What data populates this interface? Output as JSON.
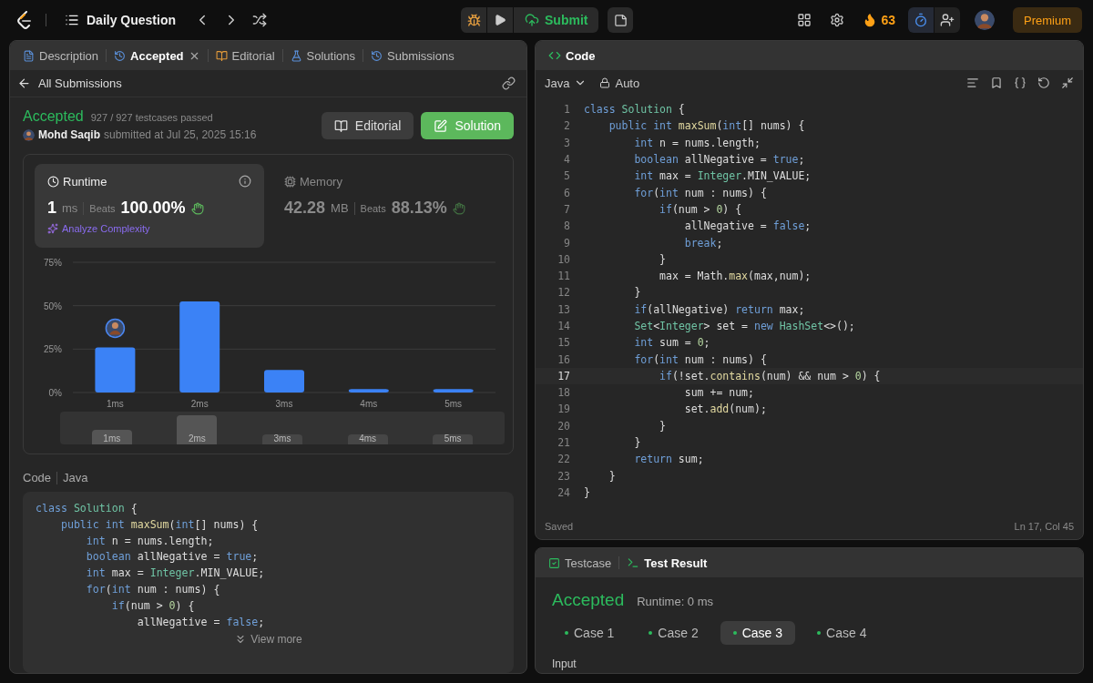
{
  "topbar": {
    "title": "Daily Question",
    "submit": "Submit",
    "streak": "63",
    "premium": "Premium"
  },
  "left": {
    "tabs": [
      {
        "label": "Description",
        "kind": "description",
        "selected": false
      },
      {
        "label": "Accepted",
        "kind": "accepted",
        "selected": true
      },
      {
        "label": "Editorial",
        "kind": "editorial",
        "selected": false
      },
      {
        "label": "Solutions",
        "kind": "solutions",
        "selected": false
      },
      {
        "label": "Submissions",
        "kind": "submissions",
        "selected": false
      }
    ],
    "back_link": "All Submissions",
    "result": {
      "status": "Accepted",
      "testcases": "927 / 927 testcases passed",
      "author": "Mohd Saqib",
      "submitted": "submitted at Jul 25, 2025 15:16"
    },
    "buttons": [
      {
        "label": "Editorial",
        "kind": "secondary"
      },
      {
        "label": "Solution",
        "kind": "primary"
      }
    ],
    "metrics": [
      {
        "kind": "runtime",
        "title": "Runtime",
        "value": "1",
        "unit": "ms",
        "beats_label": "Beats",
        "beats": "100.00%",
        "action": "Analyze Complexity",
        "selected": true
      },
      {
        "kind": "memory",
        "title": "Memory",
        "value": "42.28",
        "unit": "MB",
        "beats_label": "Beats",
        "beats": "88.13%",
        "selected": false
      }
    ],
    "chart_data": {
      "type": "bar",
      "categories": [
        "1ms",
        "2ms",
        "3ms",
        "4ms",
        "5ms"
      ],
      "series": [
        {
          "color": "#3b82f6",
          "values": [
            26,
            52.5,
            13,
            2,
            2
          ]
        }
      ],
      "ylim": [
        0,
        75
      ],
      "yticks": [
        {
          "value": 0,
          "label": "0%"
        },
        {
          "value": 25,
          "label": "25%"
        },
        {
          "value": 50,
          "label": "50%"
        },
        {
          "value": 75,
          "label": "75%"
        }
      ],
      "annotations": [
        {
          "x": "1ms"
        }
      ]
    },
    "overview_labels": [
      "1ms",
      "2ms",
      "3ms",
      "4ms",
      "5ms"
    ],
    "code_preview": {
      "label": "Code",
      "language": "Java",
      "view_more": "View more",
      "lines": [
        {
          "tokens": [
            {
              "kind": "kw",
              "text": "class "
            },
            {
              "kind": "type",
              "text": "Solution"
            },
            {
              "kind": "plain",
              "text": " {"
            }
          ]
        },
        {
          "tokens": [
            {
              "kind": "kw",
              "text": "    public int "
            },
            {
              "kind": "fn",
              "text": "maxSum"
            },
            {
              "kind": "plain",
              "text": "("
            },
            {
              "kind": "kw",
              "text": "int"
            },
            {
              "kind": "plain",
              "text": "[] nums) {"
            }
          ]
        },
        {
          "tokens": [
            {
              "kind": "kw",
              "text": "        int "
            },
            {
              "kind": "plain",
              "text": "n = nums.length;"
            }
          ]
        },
        {
          "tokens": [
            {
              "kind": "kw",
              "text": "        boolean "
            },
            {
              "kind": "plain",
              "text": "allNegative = "
            },
            {
              "kind": "kw",
              "text": "true"
            },
            {
              "kind": "plain",
              "text": ";"
            }
          ]
        },
        {
          "tokens": [
            {
              "kind": "kw",
              "text": "        int "
            },
            {
              "kind": "plain",
              "text": "max = "
            },
            {
              "kind": "type",
              "text": "Integer"
            },
            {
              "kind": "plain",
              "text": ".MIN_VALUE;"
            }
          ]
        },
        {
          "tokens": [
            {
              "kind": "kw",
              "text": "        for"
            },
            {
              "kind": "plain",
              "text": "("
            },
            {
              "kind": "kw",
              "text": "int "
            },
            {
              "kind": "plain",
              "text": "num : nums) {"
            }
          ]
        },
        {
          "tokens": [
            {
              "kind": "kw",
              "text": "            if"
            },
            {
              "kind": "plain",
              "text": "(num > "
            },
            {
              "kind": "num",
              "text": "0"
            },
            {
              "kind": "plain",
              "text": ") {"
            }
          ]
        },
        {
          "tokens": [
            {
              "kind": "plain",
              "text": "                allNegative = "
            },
            {
              "kind": "kw",
              "text": "false"
            },
            {
              "kind": "plain",
              "text": ";"
            }
          ]
        }
      ]
    }
  },
  "editor": {
    "title": "Code",
    "language": "Java",
    "mode": "Auto",
    "status_left": "Saved",
    "status_right": "Ln 17, Col 45",
    "lines": [
      {
        "number": "1",
        "current": false,
        "tokens": [
          {
            "kind": "kw",
            "text": "class "
          },
          {
            "kind": "type",
            "text": "Solution"
          },
          {
            "kind": "plain",
            "text": " {"
          }
        ]
      },
      {
        "number": "2",
        "current": false,
        "tokens": [
          {
            "kind": "kw",
            "text": "    public int "
          },
          {
            "kind": "fn",
            "text": "maxSum"
          },
          {
            "kind": "plain",
            "text": "("
          },
          {
            "kind": "kw",
            "text": "int"
          },
          {
            "kind": "plain",
            "text": "[] nums) {"
          }
        ]
      },
      {
        "number": "3",
        "current": false,
        "tokens": [
          {
            "kind": "kw",
            "text": "        int "
          },
          {
            "kind": "plain",
            "text": "n = nums.length;"
          }
        ]
      },
      {
        "number": "4",
        "current": false,
        "tokens": [
          {
            "kind": "kw",
            "text": "        boolean "
          },
          {
            "kind": "plain",
            "text": "allNegative = "
          },
          {
            "kind": "kw",
            "text": "true"
          },
          {
            "kind": "plain",
            "text": ";"
          }
        ]
      },
      {
        "number": "5",
        "current": false,
        "tokens": [
          {
            "kind": "kw",
            "text": "        int "
          },
          {
            "kind": "plain",
            "text": "max = "
          },
          {
            "kind": "type",
            "text": "Integer"
          },
          {
            "kind": "plain",
            "text": ".MIN_VALUE;"
          }
        ]
      },
      {
        "number": "6",
        "current": false,
        "tokens": [
          {
            "kind": "kw",
            "text": "        for"
          },
          {
            "kind": "plain",
            "text": "("
          },
          {
            "kind": "kw",
            "text": "int "
          },
          {
            "kind": "plain",
            "text": "num : nums) {"
          }
        ]
      },
      {
        "number": "7",
        "current": false,
        "tokens": [
          {
            "kind": "kw",
            "text": "            if"
          },
          {
            "kind": "plain",
            "text": "(num > "
          },
          {
            "kind": "num",
            "text": "0"
          },
          {
            "kind": "plain",
            "text": ") {"
          }
        ]
      },
      {
        "number": "8",
        "current": false,
        "tokens": [
          {
            "kind": "plain",
            "text": "                allNegative = "
          },
          {
            "kind": "kw",
            "text": "false"
          },
          {
            "kind": "plain",
            "text": ";"
          }
        ]
      },
      {
        "number": "9",
        "current": false,
        "tokens": [
          {
            "kind": "kw",
            "text": "                break"
          },
          {
            "kind": "plain",
            "text": ";"
          }
        ]
      },
      {
        "number": "10",
        "current": false,
        "tokens": [
          {
            "kind": "plain",
            "text": "            }"
          }
        ]
      },
      {
        "number": "11",
        "current": false,
        "tokens": [
          {
            "kind": "plain",
            "text": "            max = Math."
          },
          {
            "kind": "fn",
            "text": "max"
          },
          {
            "kind": "plain",
            "text": "(max,num);"
          }
        ]
      },
      {
        "number": "12",
        "current": false,
        "tokens": [
          {
            "kind": "plain",
            "text": "        }"
          }
        ]
      },
      {
        "number": "13",
        "current": false,
        "tokens": [
          {
            "kind": "kw",
            "text": "        if"
          },
          {
            "kind": "plain",
            "text": "(allNegative) "
          },
          {
            "kind": "kw",
            "text": "return "
          },
          {
            "kind": "plain",
            "text": "max;"
          }
        ]
      },
      {
        "number": "14",
        "current": false,
        "tokens": [
          {
            "kind": "type",
            "text": "        Set"
          },
          {
            "kind": "plain",
            "text": "<"
          },
          {
            "kind": "type",
            "text": "Integer"
          },
          {
            "kind": "plain",
            "text": "> set = "
          },
          {
            "kind": "kw",
            "text": "new "
          },
          {
            "kind": "type",
            "text": "HashSet"
          },
          {
            "kind": "plain",
            "text": "<>();"
          }
        ]
      },
      {
        "number": "15",
        "current": false,
        "tokens": [
          {
            "kind": "kw",
            "text": "        int "
          },
          {
            "kind": "plain",
            "text": "sum = "
          },
          {
            "kind": "num",
            "text": "0"
          },
          {
            "kind": "plain",
            "text": ";"
          }
        ]
      },
      {
        "number": "16",
        "current": false,
        "tokens": [
          {
            "kind": "kw",
            "text": "        for"
          },
          {
            "kind": "plain",
            "text": "("
          },
          {
            "kind": "kw",
            "text": "int "
          },
          {
            "kind": "plain",
            "text": "num : nums) {"
          }
        ]
      },
      {
        "number": "17",
        "current": true,
        "tokens": [
          {
            "kind": "kw",
            "text": "            if"
          },
          {
            "kind": "plain",
            "text": "(!set."
          },
          {
            "kind": "fn",
            "text": "contains"
          },
          {
            "kind": "plain",
            "text": "(num) && num > "
          },
          {
            "kind": "num",
            "text": "0"
          },
          {
            "kind": "plain",
            "text": ") {"
          }
        ]
      },
      {
        "number": "18",
        "current": false,
        "tokens": [
          {
            "kind": "plain",
            "text": "                sum += num;"
          }
        ]
      },
      {
        "number": "19",
        "current": false,
        "tokens": [
          {
            "kind": "plain",
            "text": "                set."
          },
          {
            "kind": "fn",
            "text": "add"
          },
          {
            "kind": "plain",
            "text": "(num);"
          }
        ]
      },
      {
        "number": "20",
        "current": false,
        "tokens": [
          {
            "kind": "plain",
            "text": "            }"
          }
        ]
      },
      {
        "number": "21",
        "current": false,
        "tokens": [
          {
            "kind": "plain",
            "text": "        }"
          }
        ]
      },
      {
        "number": "22",
        "current": false,
        "tokens": [
          {
            "kind": "kw",
            "text": "        return "
          },
          {
            "kind": "plain",
            "text": "sum;"
          }
        ]
      },
      {
        "number": "23",
        "current": false,
        "tokens": [
          {
            "kind": "plain",
            "text": "    }"
          }
        ]
      },
      {
        "number": "24",
        "current": false,
        "tokens": [
          {
            "kind": "plain",
            "text": "}"
          }
        ]
      }
    ]
  },
  "tests": {
    "tabs": [
      {
        "label": "Testcase",
        "kind": "testcase",
        "selected": false
      },
      {
        "label": "Test Result",
        "kind": "result",
        "selected": true
      }
    ],
    "status": "Accepted",
    "runtime": "Runtime: 0 ms",
    "cases": [
      {
        "label": "Case 1",
        "selected": false
      },
      {
        "label": "Case 2",
        "selected": false
      },
      {
        "label": "Case 3",
        "selected": true
      },
      {
        "label": "Case 4",
        "selected": false
      }
    ],
    "input_label": "Input"
  }
}
